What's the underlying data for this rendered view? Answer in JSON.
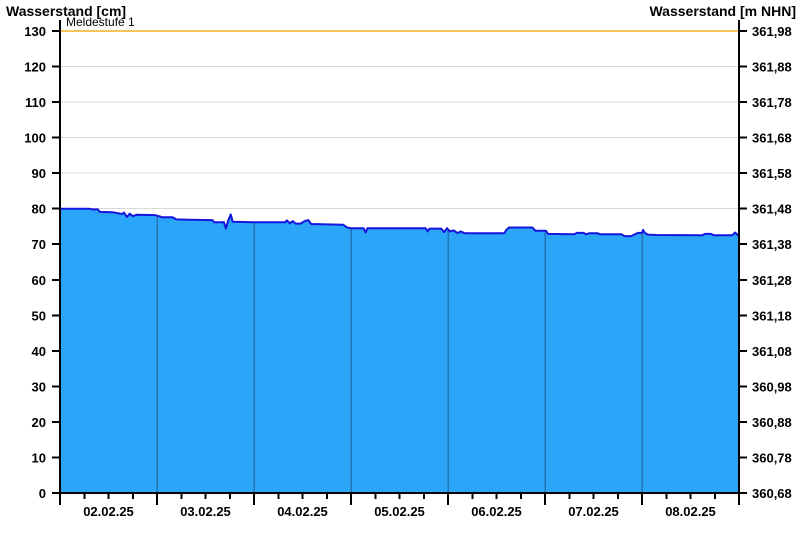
{
  "header": {
    "left_axis_title": "Wasserstand [cm]",
    "right_axis_title": "Wasserstand [m NHN]"
  },
  "chart_data": {
    "type": "area",
    "title": "",
    "x_axis": {
      "labels": [
        "02.02.25",
        "03.02.25",
        "04.02.25",
        "05.02.25",
        "06.02.25",
        "07.02.25",
        "08.02.25"
      ],
      "range_days": [
        0,
        7
      ],
      "major_tick_every_days": 1,
      "minor_tick_every_days": 0.25
    },
    "y_left_axis": {
      "label": "Wasserstand [cm]",
      "ticks": [
        0,
        10,
        20,
        30,
        40,
        50,
        60,
        70,
        80,
        90,
        100,
        110,
        120,
        130
      ],
      "range": [
        0,
        130
      ]
    },
    "y_right_axis": {
      "label": "Wasserstand [m NHN]",
      "tick_labels": [
        "360,68",
        "360,78",
        "360,88",
        "360,98",
        "361,08",
        "361,18",
        "361,28",
        "361,38",
        "361,48",
        "361,58",
        "361,68",
        "361,78",
        "361,88",
        "361,98"
      ]
    },
    "threshold": {
      "label": "Meldestufe 1",
      "value_cm": 130
    },
    "grid": "horizontal-only",
    "legend": "none",
    "series": [
      {
        "name": "Wasserstand",
        "unit": "cm",
        "points": [
          [
            0.0,
            80.0
          ],
          [
            0.3,
            80.0
          ],
          [
            0.33,
            79.8
          ],
          [
            0.39,
            79.8
          ],
          [
            0.41,
            79.1
          ],
          [
            0.54,
            79.0
          ],
          [
            0.64,
            78.5
          ],
          [
            0.66,
            78.9
          ],
          [
            0.69,
            77.7
          ],
          [
            0.72,
            78.6
          ],
          [
            0.75,
            77.9
          ],
          [
            0.79,
            78.3
          ],
          [
            0.98,
            78.2
          ],
          [
            1.03,
            77.8
          ],
          [
            1.05,
            77.6
          ],
          [
            1.16,
            77.6
          ],
          [
            1.2,
            77.0
          ],
          [
            1.34,
            76.9
          ],
          [
            1.57,
            76.8
          ],
          [
            1.59,
            76.2
          ],
          [
            1.69,
            76.2
          ],
          [
            1.71,
            74.4
          ],
          [
            1.73,
            76.3
          ],
          [
            1.76,
            78.4
          ],
          [
            1.78,
            76.3
          ],
          [
            2.0,
            76.2
          ],
          [
            2.32,
            76.2
          ],
          [
            2.34,
            76.7
          ],
          [
            2.37,
            75.9
          ],
          [
            2.4,
            76.5
          ],
          [
            2.43,
            75.8
          ],
          [
            2.48,
            75.8
          ],
          [
            2.53,
            76.6
          ],
          [
            2.56,
            76.8
          ],
          [
            2.59,
            75.7
          ],
          [
            2.92,
            75.5
          ],
          [
            2.96,
            74.7
          ],
          [
            3.0,
            74.5
          ],
          [
            3.13,
            74.5
          ],
          [
            3.15,
            73.3
          ],
          [
            3.17,
            74.5
          ],
          [
            3.77,
            74.5
          ],
          [
            3.79,
            73.6
          ],
          [
            3.81,
            74.4
          ],
          [
            3.93,
            74.4
          ],
          [
            3.96,
            73.4
          ],
          [
            3.99,
            74.5
          ],
          [
            4.02,
            73.6
          ],
          [
            4.06,
            73.9
          ],
          [
            4.1,
            73.1
          ],
          [
            4.13,
            73.6
          ],
          [
            4.17,
            73.1
          ],
          [
            4.24,
            73.1
          ],
          [
            4.58,
            73.1
          ],
          [
            4.6,
            74.0
          ],
          [
            4.63,
            74.7
          ],
          [
            4.87,
            74.7
          ],
          [
            4.9,
            73.8
          ],
          [
            5.01,
            73.8
          ],
          [
            5.03,
            72.9
          ],
          [
            5.3,
            72.8
          ],
          [
            5.33,
            73.2
          ],
          [
            5.4,
            73.2
          ],
          [
            5.42,
            72.8
          ],
          [
            5.46,
            73.1
          ],
          [
            5.54,
            73.1
          ],
          [
            5.57,
            72.8
          ],
          [
            5.79,
            72.8
          ],
          [
            5.82,
            72.3
          ],
          [
            5.89,
            72.3
          ],
          [
            5.92,
            72.7
          ],
          [
            5.96,
            73.2
          ],
          [
            6.0,
            73.2
          ],
          [
            6.01,
            74.0
          ],
          [
            6.03,
            73.2
          ],
          [
            6.06,
            72.7
          ],
          [
            6.15,
            72.6
          ],
          [
            6.62,
            72.5
          ],
          [
            6.65,
            72.9
          ],
          [
            6.71,
            72.9
          ],
          [
            6.74,
            72.5
          ],
          [
            6.93,
            72.5
          ],
          [
            6.96,
            73.3
          ],
          [
            6.99,
            72.5
          ],
          [
            7.0,
            72.5
          ]
        ]
      }
    ],
    "colors": {
      "area_fill": "#2aa5f7",
      "series_line": "#1515dd",
      "day_boundary_line": "#2272b4",
      "gridline": "#d9d9d9",
      "threshold_line": "#f7c35a",
      "axis": "#000000",
      "text": "#000000",
      "background": "#ffffff"
    }
  }
}
